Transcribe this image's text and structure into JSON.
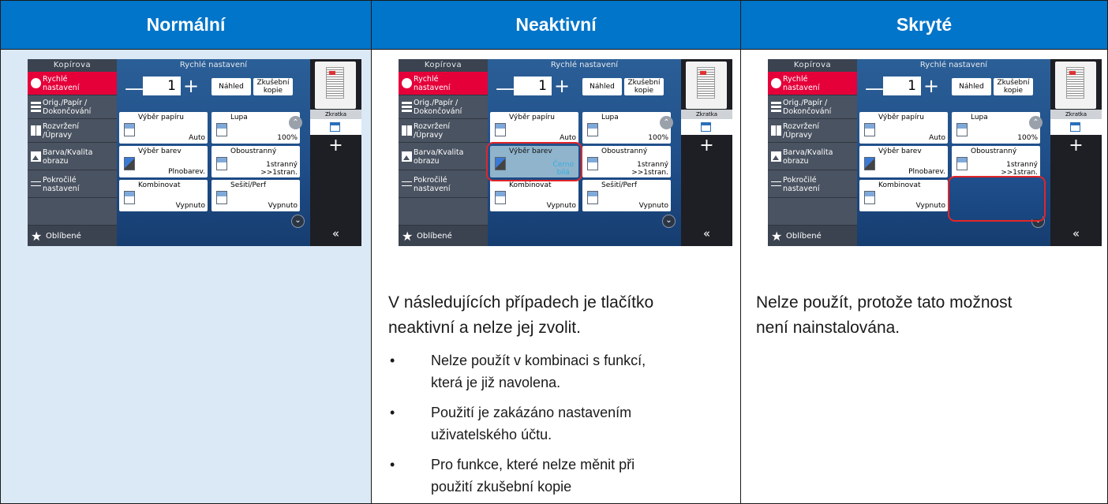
{
  "headers": [
    "Normální",
    "Neaktivní",
    "Skryté"
  ],
  "colors": {
    "header_bg": "#0075c9",
    "cell_bg": "#dbe9f6",
    "highlight": "#e2262a",
    "sidebar_active": "#e5003a"
  },
  "screen": {
    "sidebar_title": "Kopírova",
    "sidebar_items": [
      {
        "icon": "timer-icon",
        "line1": "Rychlé",
        "line2": "nastavení"
      },
      {
        "icon": "paper-icon",
        "line1": "Orig./Papír /",
        "line2": "Dokončování"
      },
      {
        "icon": "layout-icon",
        "line1": "Rozvržení",
        "line2": "/Úpravy"
      },
      {
        "icon": "image-quality-icon",
        "line1": "Barva/Kvalita",
        "line2": "obrazu"
      },
      {
        "icon": "advanced-settings-icon",
        "line1": "Pokročilé",
        "line2": "nastavení"
      }
    ],
    "favorites_label": "Oblíbené",
    "main_title": "Rychlé nastavení",
    "copies_value": "1",
    "minus_symbol": "—",
    "plus_symbol": "+",
    "preview_button": "Náhled",
    "test_copy_line1": "Zkušební",
    "test_copy_line2": "kopie",
    "tiles": {
      "paper": {
        "label": "Výběr papíru",
        "value": "Auto"
      },
      "zoom": {
        "label": "Lupa",
        "value": "100%"
      },
      "color": {
        "label": "Výběr barev",
        "value": "Plnobarev."
      },
      "color_inactive_line1": "Černo",
      "color_inactive_line2": "bílá",
      "duplex": {
        "label": "Oboustranný",
        "value_line1": "1stranný",
        "value_line2": ">>1stran."
      },
      "combine": {
        "label": "Kombinovat",
        "value": "Vypnuto"
      },
      "staple": {
        "label": "Sešití/Perf",
        "value": "Vypnuto"
      }
    },
    "shortcut_label": "Zkratka",
    "right_plus": "+",
    "collapse_symbol": "«",
    "chevron_up": "⌃",
    "chevron_down": "⌄"
  },
  "descriptions": {
    "inactive_intro_line1": "V následujících případech je tlačítko",
    "inactive_intro_line2": "neaktivní a nelze jej zvolit.",
    "bullets": [
      {
        "line1": "Nelze použít v kombinaci s funkcí,",
        "line2": "která je již navolena."
      },
      {
        "line1": "Použití je zakázáno nastavením",
        "line2": "uživatelského účtu."
      },
      {
        "line1": "Pro funkce, které nelze měnit při",
        "line2": "použití zkušební kopie"
      }
    ],
    "bullet_symbol": "•",
    "hidden_line1": "Nelze použít, protože tato možnost",
    "hidden_line2": "není nainstalována."
  }
}
